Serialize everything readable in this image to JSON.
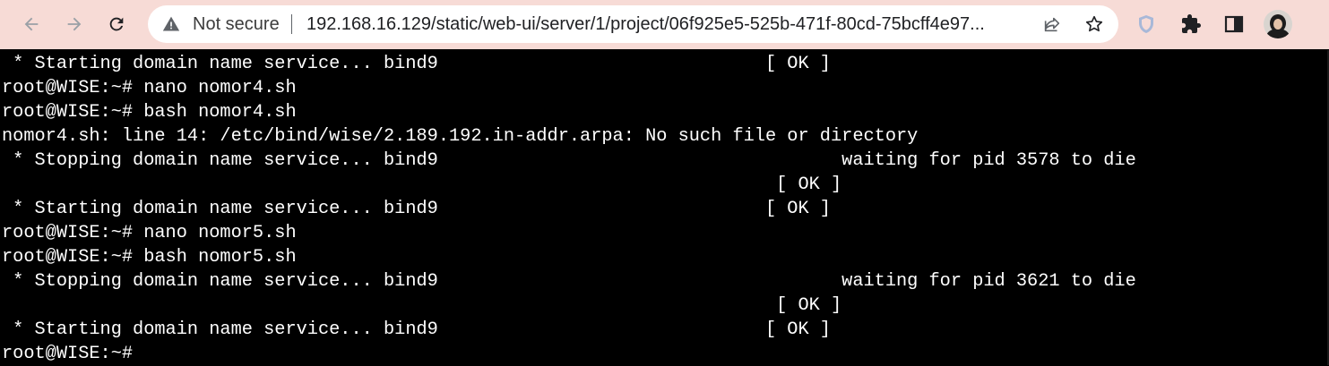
{
  "browser": {
    "security_label": "Not secure",
    "url": "192.168.16.129/static/web-ui/server/1/project/06f925e5-525b-471f-80cd-75bcff4e97...",
    "icons": {
      "back": "arrow-left-icon",
      "forward": "arrow-right-icon",
      "reload": "reload-icon",
      "warning": "warning-triangle-icon",
      "share": "share-icon",
      "bookmark": "star-icon",
      "extension": "shield-extension-icon",
      "extensions": "puzzle-icon",
      "side_panel": "side-panel-icon"
    },
    "colors": {
      "toolbar_bg": "#f7dbd6",
      "omnibox_bg": "#ffffff"
    }
  },
  "terminal": {
    "lines": [
      " * Starting domain name service... bind9                              [ OK ]",
      "root@WISE:~# nano nomor4.sh",
      "root@WISE:~# bash nomor4.sh",
      "nomor4.sh: line 14: /etc/bind/wise/2.189.192.in-addr.arpa: No such file or directory",
      " * Stopping domain name service... bind9                                     waiting for pid 3578 to die",
      "                                                                       [ OK ]",
      " * Starting domain name service... bind9                              [ OK ]",
      "root@WISE:~# nano nomor5.sh",
      "root@WISE:~# bash nomor5.sh",
      " * Stopping domain name service... bind9                                     waiting for pid 3621 to die",
      "                                                                       [ OK ]",
      " * Starting domain name service... bind9                              [ OK ]",
      "root@WISE:~#"
    ],
    "colors": {
      "background": "#000000",
      "foreground": "#ffffff"
    }
  }
}
